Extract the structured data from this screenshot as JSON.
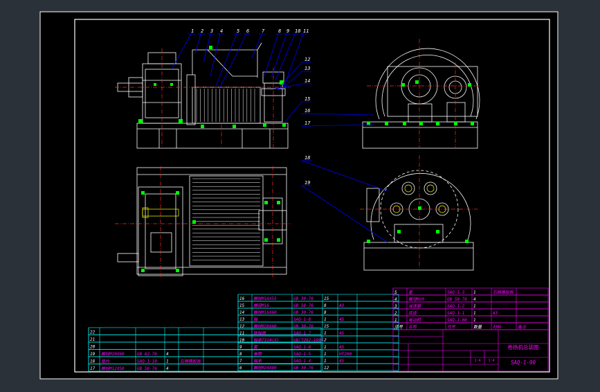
{
  "balloons": [
    "1",
    "2",
    "3",
    "4",
    "5",
    "6",
    "7",
    "8",
    "9",
    "10",
    "11",
    "12",
    "13",
    "14",
    "15",
    "16",
    "17",
    "18",
    "19"
  ],
  "bom_left": [
    {
      "no": "22",
      "name": "",
      "code": "",
      "qty": "",
      "mat": ""
    },
    {
      "no": "21",
      "name": "",
      "code": "",
      "qty": "",
      "mat": ""
    },
    {
      "no": "20",
      "name": "",
      "code": "",
      "qty": "",
      "mat": ""
    },
    {
      "no": "19",
      "name": "螺栓M20X60",
      "code": "GB 62-76",
      "qty": "4",
      "mat": ""
    },
    {
      "no": "18",
      "name": "垫片",
      "code": "SAQ-1-10",
      "qty": "1",
      "mat": "石棉橡胶板"
    },
    {
      "no": "17",
      "name": "螺栓M12X50",
      "code": "GB 58-76",
      "qty": "4",
      "mat": ""
    }
  ],
  "bom_mid": [
    {
      "no": "16",
      "name": "螺栓M16X55",
      "code": "GB 30-76",
      "qty": "15",
      "mat": ""
    },
    {
      "no": "15",
      "name": "螺母M16",
      "code": "GB 58-76",
      "qty": "8",
      "mat": "A3"
    },
    {
      "no": "14",
      "name": "螺栓M16X60",
      "code": "GB 30-76",
      "qty": "8",
      "mat": ""
    },
    {
      "no": "13",
      "name": "轴",
      "code": "SAQ-1-8",
      "qty": "1",
      "mat": "45"
    },
    {
      "no": "12",
      "name": "螺栓M20X60",
      "code": "GB 30-76",
      "qty": "15",
      "mat": ""
    },
    {
      "no": "11",
      "name": "联轴器",
      "code": "SAQ-1-7",
      "qty": "1",
      "mat": "45"
    },
    {
      "no": "10",
      "name": "轴承7314(X)",
      "code": "GB/T292-1994",
      "qty": "2",
      "mat": ""
    },
    {
      "no": "9",
      "name": "套",
      "code": "SAQ-1-6",
      "qty": "1",
      "mat": "45"
    },
    {
      "no": "8",
      "name": "卷筒",
      "code": "SAQ-1-5",
      "qty": "1",
      "mat": "HT200"
    },
    {
      "no": "7",
      "name": "轴承",
      "code": "SAQ-1-4",
      "qty": "1",
      "mat": "45"
    },
    {
      "no": "6",
      "name": "螺栓M24X80",
      "code": "GB 30-76",
      "qty": "12",
      "mat": ""
    }
  ],
  "bom_right": [
    {
      "no": "5",
      "name": "盖",
      "code": "SAQ-1-3",
      "qty": "1",
      "mat": "石棉橡胶板"
    },
    {
      "no": "4",
      "name": "螺母M20",
      "code": "GB 58-76",
      "qty": "4",
      "mat": ""
    },
    {
      "no": "3",
      "name": "减速器",
      "code": "SAQ-1-2",
      "qty": "1",
      "mat": ""
    },
    {
      "no": "2",
      "name": "底座",
      "code": "SAQ-1-1",
      "qty": "1",
      "mat": "A3"
    },
    {
      "no": "1",
      "name": "电动机",
      "code": "SAQ-1-00",
      "qty": "1",
      "mat": ""
    }
  ],
  "bom_header": {
    "no": "序号",
    "name": "名称",
    "code": "代号",
    "qty": "数量",
    "mat": "材料",
    "note": "备注"
  },
  "title_block": {
    "drawing_title": "卷扬机总装图",
    "drawing_no": "SAQ-1-00",
    "scale": "1:4",
    "sheet": "1:4"
  },
  "colors": {
    "background": "#2b3138",
    "sheet": "#000000",
    "border": "#ffffff",
    "outline": "#ffffff",
    "centerline": "#ff2a2a",
    "dims": "#00ffff",
    "bolt": "#00ff00",
    "balloon": "#0000ff",
    "text": "#ff00ff",
    "yellow": "#ffff00"
  }
}
